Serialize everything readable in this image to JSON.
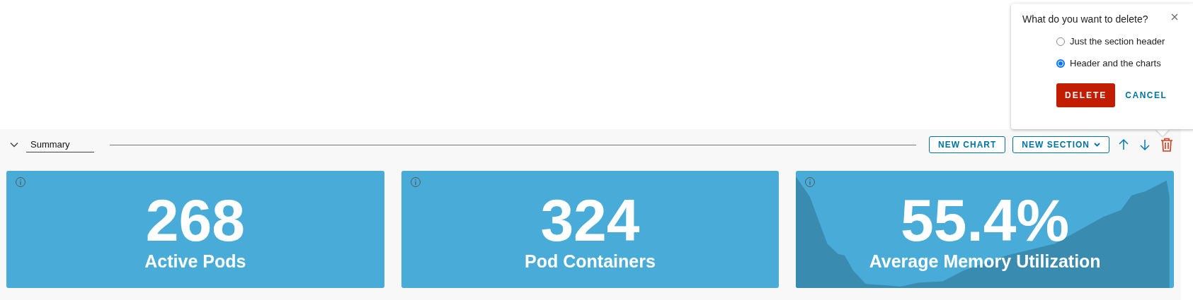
{
  "section": {
    "title": "Summary",
    "expanded": true
  },
  "toolbar": {
    "new_chart": "NEW CHART",
    "new_section": "NEW SECTION"
  },
  "popover": {
    "title": "What do you want to delete?",
    "options": [
      {
        "label": "Just the section header",
        "selected": false
      },
      {
        "label": "Header and the charts",
        "selected": true
      }
    ],
    "confirm": "DELETE",
    "cancel": "CANCEL"
  },
  "cards": [
    {
      "value": "268",
      "label": "Active Pods",
      "kind": "plain"
    },
    {
      "value": "324",
      "label": "Pod Containers",
      "kind": "plain"
    },
    {
      "value": "55.4%",
      "label": "Average Memory Utilization",
      "kind": "sparkline"
    }
  ]
}
